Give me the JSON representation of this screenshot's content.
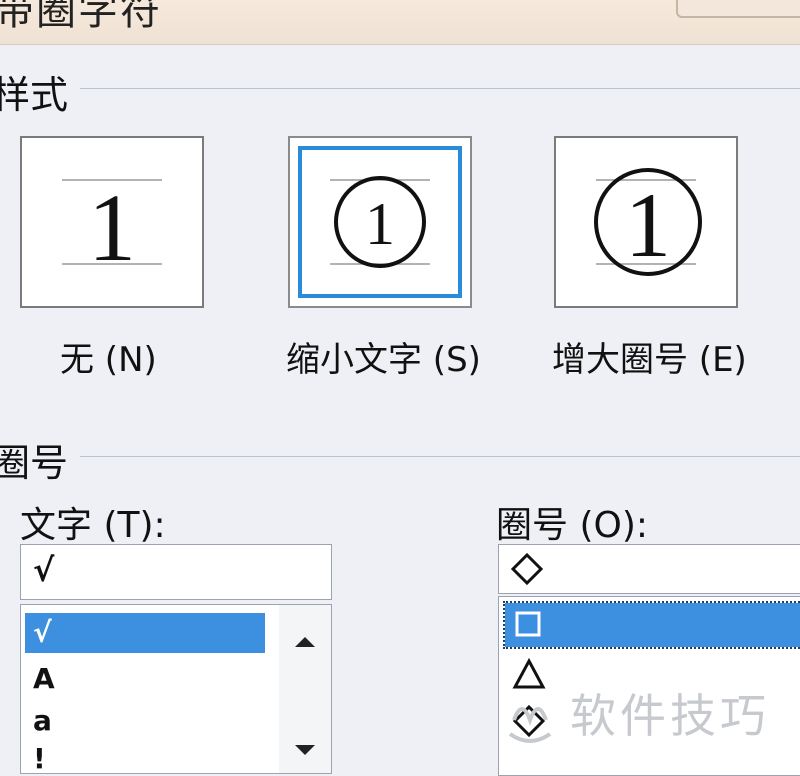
{
  "window": {
    "title": "带圈字符"
  },
  "style_section": {
    "label": "样式",
    "options": [
      {
        "label": "无 (N)",
        "glyph": "1",
        "selected": false
      },
      {
        "label": "缩小文字 (S)",
        "glyph": "1",
        "selected": true
      },
      {
        "label": "增大圈号 (E)",
        "glyph": "1",
        "selected": false
      }
    ]
  },
  "ring_section": {
    "label": "圈号",
    "text_field": {
      "label": "文字 (T):",
      "value": "√",
      "items": [
        {
          "text": "√",
          "selected": true
        },
        {
          "text": "A",
          "selected": false
        },
        {
          "text": "a",
          "selected": false
        },
        {
          "text": "!",
          "selected": false
        }
      ]
    },
    "ring_field": {
      "label": "圈号 (O):",
      "value_icon": "diamond-icon",
      "items": [
        {
          "icon": "square-icon",
          "selected": true
        },
        {
          "icon": "triangle-icon",
          "selected": false
        },
        {
          "icon": "diamond-icon",
          "selected": false
        }
      ]
    }
  },
  "watermark": {
    "text": "软件技巧"
  },
  "colors": {
    "selection": "#3d8fe0",
    "focus_border": "#2a8bd9",
    "background": "#eef0f5"
  }
}
